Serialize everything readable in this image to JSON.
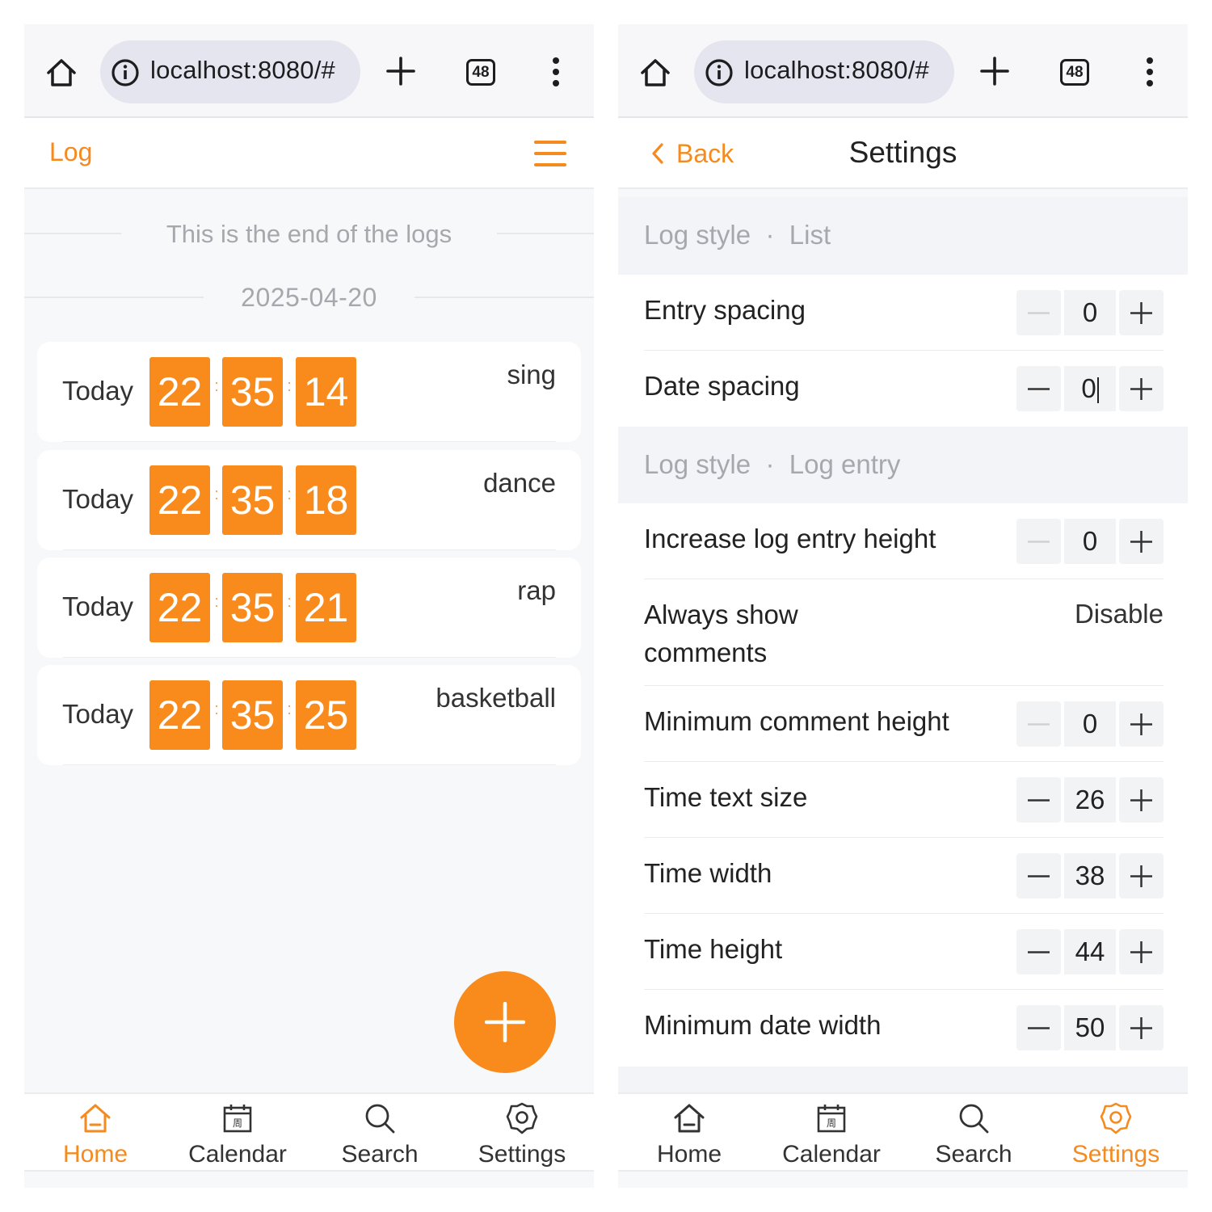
{
  "browser": {
    "url": "localhost:8080/#",
    "tab_count": "48"
  },
  "left_screen": {
    "nav": {
      "title": "Log"
    },
    "end_message": "This is the end of the logs",
    "date": "2025-04-20",
    "entries": [
      {
        "day": "Today",
        "hour": "22",
        "minute": "35",
        "second": "14",
        "label": "sing"
      },
      {
        "day": "Today",
        "hour": "22",
        "minute": "35",
        "second": "18",
        "label": "dance"
      },
      {
        "day": "Today",
        "hour": "22",
        "minute": "35",
        "second": "21",
        "label": "rap"
      },
      {
        "day": "Today",
        "hour": "22",
        "minute": "35",
        "second": "25",
        "label": "basketball"
      }
    ],
    "time_separator": ":"
  },
  "right_screen": {
    "nav": {
      "back_label": "Back",
      "title": "Settings"
    },
    "section_list": {
      "prefix": "Log style",
      "dot": "·",
      "name": "List"
    },
    "section_entry": {
      "prefix": "Log style",
      "dot": "·",
      "name": "Log entry"
    },
    "settings": {
      "entry_spacing": {
        "label": "Entry spacing",
        "value": "0"
      },
      "date_spacing": {
        "label": "Date spacing",
        "value": "0"
      },
      "increase_height": {
        "label": "Increase log entry height",
        "value": "0"
      },
      "always_show_comments": {
        "label_line1": "Always show",
        "label_line2": "comments",
        "value": "Disable"
      },
      "min_comment_height": {
        "label": "Minimum comment height",
        "value": "0"
      },
      "time_text_size": {
        "label": "Time text size",
        "value": "26"
      },
      "time_width": {
        "label": "Time width",
        "value": "38"
      },
      "time_height": {
        "label": "Time height",
        "value": "44"
      },
      "min_date_width": {
        "label": "Minimum date width",
        "value": "50"
      }
    }
  },
  "tabbar": {
    "home": "Home",
    "calendar": "Calendar",
    "calendar_glyph": "周",
    "search": "Search",
    "settings": "Settings"
  },
  "colors": {
    "accent": "#f98b1d",
    "text": "#222222",
    "muted": "#a6a8ad",
    "background": "#f7f8fa"
  },
  "icons": [
    "home-icon",
    "info-icon",
    "plus-icon",
    "tabs-icon",
    "more-vert-icon",
    "hamburger-icon",
    "chevron-left-icon",
    "minus-icon",
    "calendar-icon",
    "search-icon",
    "gear-icon"
  ]
}
